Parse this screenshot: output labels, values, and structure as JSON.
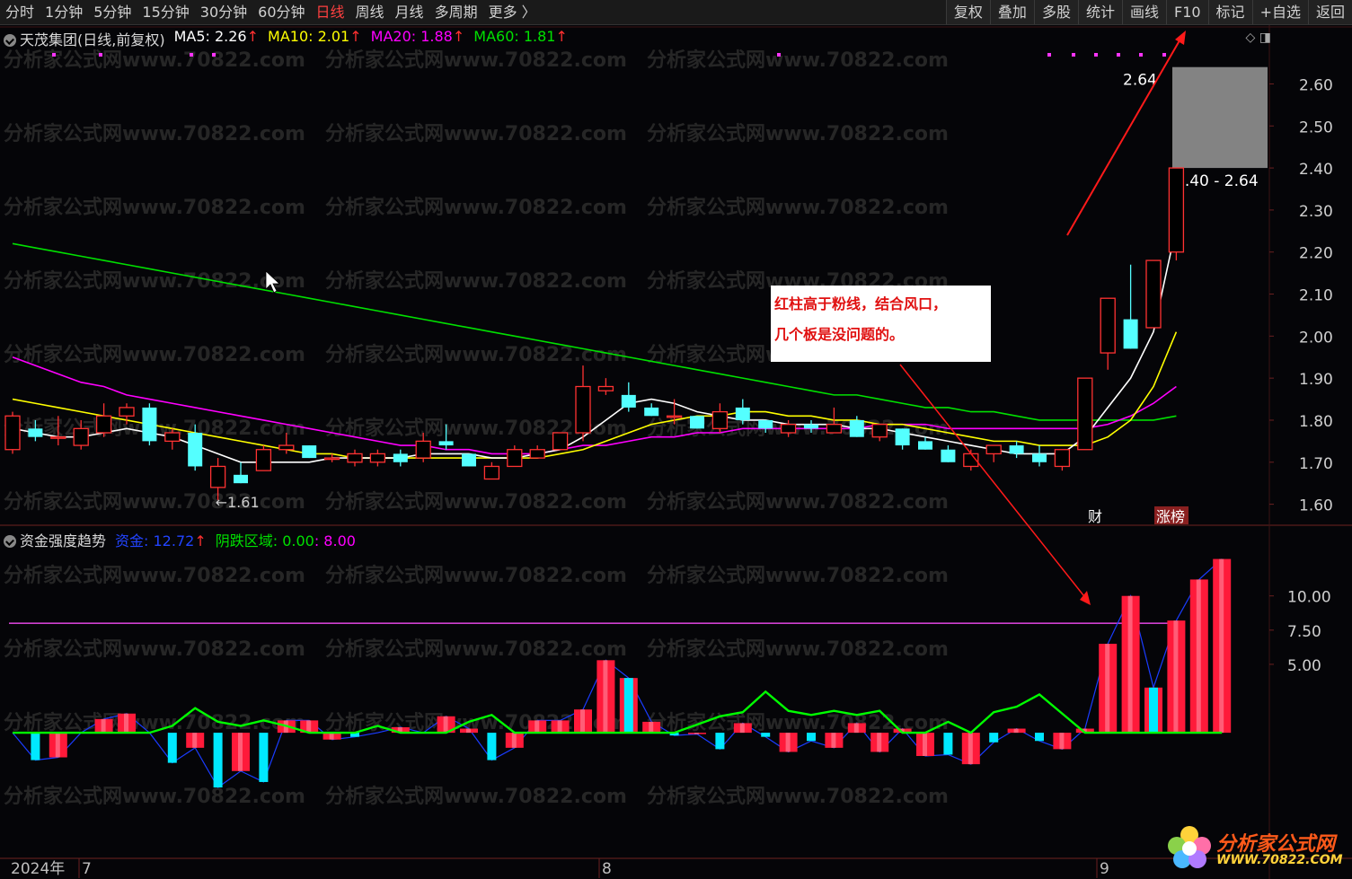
{
  "toolbar": {
    "periods": [
      "分时",
      "1分钟",
      "5分钟",
      "15分钟",
      "30分钟",
      "60分钟",
      "日线",
      "周线",
      "月线",
      "多周期",
      "更多 〉"
    ],
    "active_period": "日线",
    "right_buttons": [
      "复权",
      "叠加",
      "多股",
      "统计",
      "画线",
      "F10",
      "标记",
      "+自选",
      "返回"
    ]
  },
  "header": {
    "stock": "天茂集团(日线,前复权)",
    "ma5": "MA5: 2.26",
    "ma10": "MA10: 2.01",
    "ma20": "MA20: 1.88",
    "ma60": "MA60: 1.81",
    "up_arrow": "↑"
  },
  "indicator_header": {
    "name": "资金强度趋势",
    "fund": "资金: 12.72",
    "zone": "阴跌区域: 0.00",
    "zone_val": ": 8.00"
  },
  "annotation": {
    "line1": "红柱高于粉线，结合风口，",
    "line2": "几个板是没问题的。"
  },
  "watermark": "分析家公式网www.70822.com",
  "logo": {
    "title": "分析家公式网",
    "url": "WWW.70822.COM"
  },
  "colors": {
    "up": "#ff3232",
    "down": "#54ffff",
    "ma5": "#ffffff",
    "ma10": "#ffff00",
    "ma20": "#ff00ff",
    "ma60": "#00e000",
    "fund_line": "#00ff00",
    "threshold": "#d040d0"
  },
  "chart_data": [
    {
      "type": "candlestick",
      "ylim": [
        1.55,
        2.68
      ],
      "y_ticks": [
        1.6,
        1.7,
        1.8,
        1.9,
        2.0,
        2.1,
        2.2,
        2.3,
        2.4,
        2.5,
        2.6
      ],
      "x_labels": [
        "2024年",
        "7",
        "8",
        "9"
      ],
      "low_label": "←1.61",
      "range_label": "2.40 - 2.64",
      "high_label": "2.64",
      "badges": [
        "财",
        "涨榜"
      ],
      "candles": [
        {
          "o": 1.73,
          "h": 1.82,
          "l": 1.72,
          "c": 1.81
        },
        {
          "o": 1.78,
          "h": 1.8,
          "l": 1.75,
          "c": 1.76
        },
        {
          "o": 1.76,
          "h": 1.81,
          "l": 1.74,
          "c": 1.76
        },
        {
          "o": 1.74,
          "h": 1.8,
          "l": 1.73,
          "c": 1.78
        },
        {
          "o": 1.77,
          "h": 1.84,
          "l": 1.76,
          "c": 1.81
        },
        {
          "o": 1.81,
          "h": 1.84,
          "l": 1.79,
          "c": 1.83
        },
        {
          "o": 1.83,
          "h": 1.84,
          "l": 1.74,
          "c": 1.75
        },
        {
          "o": 1.75,
          "h": 1.78,
          "l": 1.73,
          "c": 1.77
        },
        {
          "o": 1.77,
          "h": 1.79,
          "l": 1.68,
          "c": 1.69
        },
        {
          "o": 1.64,
          "h": 1.71,
          "l": 1.61,
          "c": 1.69
        },
        {
          "o": 1.67,
          "h": 1.7,
          "l": 1.65,
          "c": 1.65
        },
        {
          "o": 1.68,
          "h": 1.74,
          "l": 1.68,
          "c": 1.73
        },
        {
          "o": 1.73,
          "h": 1.77,
          "l": 1.72,
          "c": 1.74
        },
        {
          "o": 1.74,
          "h": 1.74,
          "l": 1.71,
          "c": 1.71
        },
        {
          "o": 1.71,
          "h": 1.72,
          "l": 1.7,
          "c": 1.71
        },
        {
          "o": 1.7,
          "h": 1.73,
          "l": 1.69,
          "c": 1.72
        },
        {
          "o": 1.7,
          "h": 1.73,
          "l": 1.69,
          "c": 1.72
        },
        {
          "o": 1.72,
          "h": 1.73,
          "l": 1.69,
          "c": 1.7
        },
        {
          "o": 1.71,
          "h": 1.77,
          "l": 1.7,
          "c": 1.75
        },
        {
          "o": 1.75,
          "h": 1.79,
          "l": 1.73,
          "c": 1.74
        },
        {
          "o": 1.72,
          "h": 1.72,
          "l": 1.69,
          "c": 1.69
        },
        {
          "o": 1.66,
          "h": 1.7,
          "l": 1.66,
          "c": 1.69
        },
        {
          "o": 1.69,
          "h": 1.74,
          "l": 1.69,
          "c": 1.73
        },
        {
          "o": 1.71,
          "h": 1.74,
          "l": 1.71,
          "c": 1.73
        },
        {
          "o": 1.73,
          "h": 1.77,
          "l": 1.73,
          "c": 1.77
        },
        {
          "o": 1.77,
          "h": 1.93,
          "l": 1.75,
          "c": 1.88
        },
        {
          "o": 1.87,
          "h": 1.9,
          "l": 1.86,
          "c": 1.88
        },
        {
          "o": 1.86,
          "h": 1.89,
          "l": 1.82,
          "c": 1.83
        },
        {
          "o": 1.83,
          "h": 1.84,
          "l": 1.81,
          "c": 1.81
        },
        {
          "o": 1.81,
          "h": 1.85,
          "l": 1.79,
          "c": 1.81
        },
        {
          "o": 1.81,
          "h": 1.81,
          "l": 1.78,
          "c": 1.78
        },
        {
          "o": 1.78,
          "h": 1.84,
          "l": 1.77,
          "c": 1.82
        },
        {
          "o": 1.83,
          "h": 1.85,
          "l": 1.79,
          "c": 1.8
        },
        {
          "o": 1.8,
          "h": 1.8,
          "l": 1.77,
          "c": 1.78
        },
        {
          "o": 1.77,
          "h": 1.8,
          "l": 1.76,
          "c": 1.79
        },
        {
          "o": 1.79,
          "h": 1.8,
          "l": 1.77,
          "c": 1.78
        },
        {
          "o": 1.77,
          "h": 1.83,
          "l": 1.77,
          "c": 1.79
        },
        {
          "o": 1.8,
          "h": 1.81,
          "l": 1.76,
          "c": 1.76
        },
        {
          "o": 1.76,
          "h": 1.79,
          "l": 1.75,
          "c": 1.79
        },
        {
          "o": 1.78,
          "h": 1.78,
          "l": 1.73,
          "c": 1.74
        },
        {
          "o": 1.75,
          "h": 1.76,
          "l": 1.73,
          "c": 1.73
        },
        {
          "o": 1.73,
          "h": 1.74,
          "l": 1.7,
          "c": 1.7
        },
        {
          "o": 1.69,
          "h": 1.73,
          "l": 1.68,
          "c": 1.72
        },
        {
          "o": 1.72,
          "h": 1.74,
          "l": 1.7,
          "c": 1.74
        },
        {
          "o": 1.74,
          "h": 1.75,
          "l": 1.71,
          "c": 1.72
        },
        {
          "o": 1.72,
          "h": 1.74,
          "l": 1.69,
          "c": 1.7
        },
        {
          "o": 1.69,
          "h": 1.73,
          "l": 1.68,
          "c": 1.73
        },
        {
          "o": 1.73,
          "h": 1.9,
          "l": 1.73,
          "c": 1.9
        },
        {
          "o": 1.96,
          "h": 2.09,
          "l": 1.92,
          "c": 2.09
        },
        {
          "o": 2.04,
          "h": 2.17,
          "l": 1.97,
          "c": 1.97
        },
        {
          "o": 2.02,
          "h": 2.18,
          "l": 2.02,
          "c": 2.18
        },
        {
          "o": 2.2,
          "h": 2.4,
          "l": 2.18,
          "c": 2.4
        }
      ],
      "ma5": [
        1.78,
        1.77,
        1.76,
        1.76,
        1.77,
        1.78,
        1.77,
        1.76,
        1.74,
        1.72,
        1.7,
        1.7,
        1.7,
        1.7,
        1.71,
        1.71,
        1.71,
        1.71,
        1.72,
        1.72,
        1.72,
        1.71,
        1.71,
        1.72,
        1.73,
        1.76,
        1.8,
        1.84,
        1.85,
        1.84,
        1.82,
        1.81,
        1.8,
        1.8,
        1.79,
        1.79,
        1.79,
        1.78,
        1.78,
        1.77,
        1.76,
        1.75,
        1.74,
        1.73,
        1.72,
        1.72,
        1.72,
        1.76,
        1.83,
        1.9,
        2.01,
        2.26
      ],
      "ma10": [
        1.85,
        1.84,
        1.83,
        1.82,
        1.81,
        1.8,
        1.79,
        1.78,
        1.77,
        1.76,
        1.75,
        1.74,
        1.73,
        1.72,
        1.72,
        1.71,
        1.71,
        1.71,
        1.71,
        1.71,
        1.71,
        1.71,
        1.71,
        1.71,
        1.72,
        1.73,
        1.75,
        1.77,
        1.79,
        1.8,
        1.81,
        1.81,
        1.82,
        1.82,
        1.81,
        1.81,
        1.8,
        1.8,
        1.79,
        1.79,
        1.78,
        1.77,
        1.76,
        1.75,
        1.75,
        1.74,
        1.74,
        1.74,
        1.76,
        1.8,
        1.88,
        2.01
      ],
      "ma20": [
        1.95,
        1.93,
        1.91,
        1.89,
        1.88,
        1.86,
        1.85,
        1.84,
        1.83,
        1.82,
        1.81,
        1.8,
        1.79,
        1.78,
        1.77,
        1.76,
        1.75,
        1.74,
        1.74,
        1.73,
        1.73,
        1.72,
        1.72,
        1.72,
        1.73,
        1.74,
        1.74,
        1.75,
        1.76,
        1.76,
        1.77,
        1.77,
        1.78,
        1.78,
        1.78,
        1.78,
        1.78,
        1.78,
        1.79,
        1.79,
        1.79,
        1.78,
        1.78,
        1.78,
        1.78,
        1.78,
        1.78,
        1.78,
        1.79,
        1.81,
        1.84,
        1.88
      ],
      "ma60": [
        2.22,
        2.21,
        2.2,
        2.19,
        2.18,
        2.17,
        2.16,
        2.15,
        2.14,
        2.13,
        2.12,
        2.11,
        2.1,
        2.09,
        2.08,
        2.07,
        2.06,
        2.05,
        2.04,
        2.03,
        2.02,
        2.01,
        2.0,
        1.99,
        1.98,
        1.97,
        1.96,
        1.95,
        1.94,
        1.93,
        1.92,
        1.91,
        1.9,
        1.89,
        1.88,
        1.87,
        1.86,
        1.86,
        1.85,
        1.84,
        1.83,
        1.83,
        1.82,
        1.82,
        1.81,
        1.8,
        1.8,
        1.8,
        1.8,
        1.8,
        1.8,
        1.81
      ]
    },
    {
      "type": "bar",
      "ylim": [
        -8,
        13
      ],
      "y_ticks": [
        5.0,
        7.5,
        10.0
      ],
      "threshold": 8.0,
      "bars": [
        0,
        -2.0,
        -1.8,
        0,
        1.0,
        1.4,
        0,
        -2.2,
        -1.1,
        -4.0,
        -2.8,
        -3.6,
        0.9,
        0.9,
        -0.5,
        -0.3,
        0,
        0.4,
        0,
        1.2,
        0.3,
        -2.0,
        -1.1,
        0.9,
        0.9,
        1.7,
        5.3,
        4.0,
        0.8,
        -0.2,
        -0.1,
        -1.2,
        0.7,
        -0.3,
        -1.4,
        -0.6,
        -1.1,
        0.7,
        -1.4,
        0.3,
        -1.7,
        -1.6,
        -2.3,
        -0.7,
        0.3,
        -0.6,
        -1.2,
        0.3,
        6.5,
        10.0,
        3.3,
        8.2,
        11.2,
        12.7
      ],
      "fund_line": [
        0,
        0,
        0,
        0,
        0,
        0,
        0,
        0.5,
        1.8,
        0.8,
        0.5,
        0.9,
        0.5,
        0,
        0,
        0,
        0.5,
        0,
        0,
        0,
        0.8,
        1.3,
        0,
        0,
        0,
        0,
        0,
        0,
        0,
        0,
        0.6,
        1.2,
        1.5,
        3.0,
        1.6,
        1.3,
        1.6,
        1.3,
        1.6,
        0,
        0,
        0.8,
        0,
        1.5,
        1.9,
        2.8,
        1.4,
        0,
        0,
        0,
        0,
        0,
        0,
        0
      ]
    }
  ]
}
